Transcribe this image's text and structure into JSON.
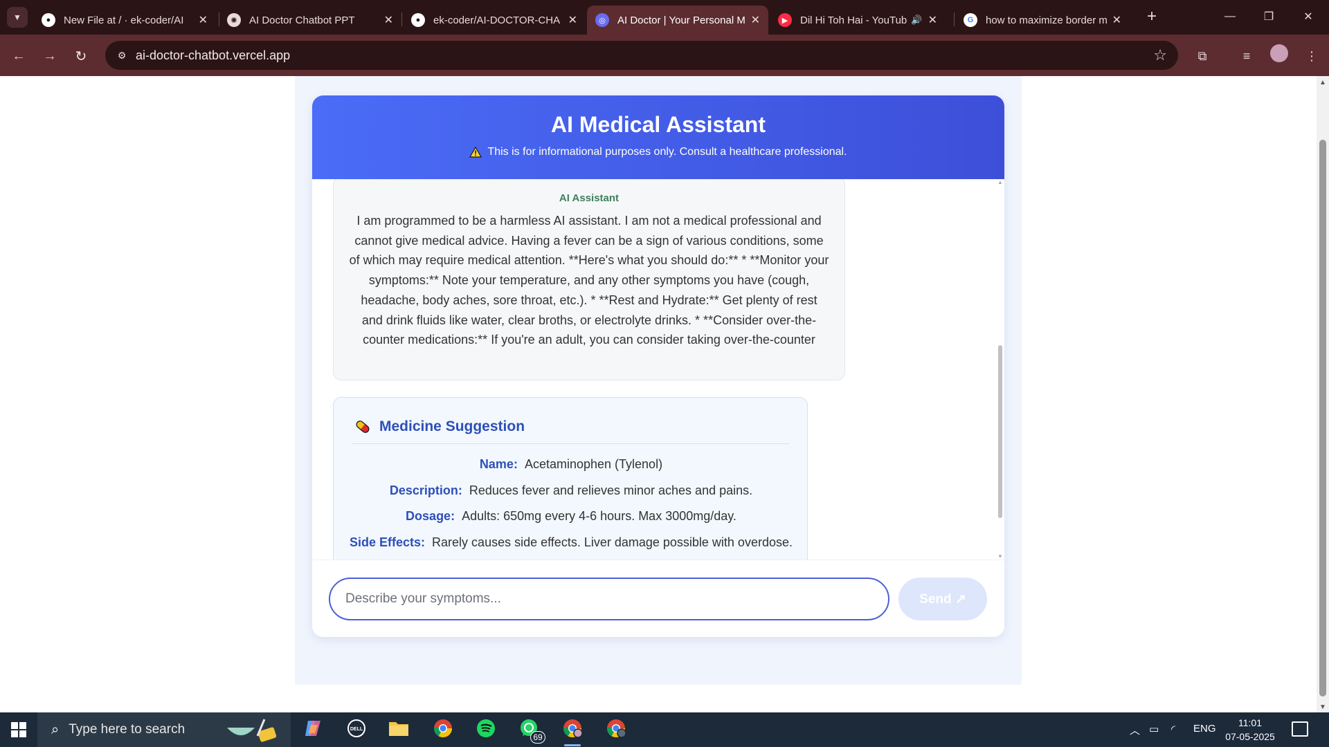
{
  "browser": {
    "tabs": [
      {
        "title": "New File at / · ek-coder/AI",
        "icon": "github-icon"
      },
      {
        "title": "AI Doctor Chatbot PPT",
        "icon": "openai-icon"
      },
      {
        "title": "ek-coder/AI-DOCTOR-CHA",
        "icon": "github-icon"
      },
      {
        "title": "AI Doctor | Your Personal M",
        "icon": "vercel-app-icon",
        "active": true
      },
      {
        "title": "Dil Hi Toh Hai - YouTub",
        "icon": "youtube-icon",
        "playing_audio": true
      },
      {
        "title": "how to maximize border m",
        "icon": "google-icon"
      }
    ],
    "url": "ai-doctor-chatbot.vercel.app"
  },
  "app": {
    "title": "AI Medical Assistant",
    "disclaimer": "This is for informational purposes only. Consult a healthcare professional.",
    "ai_message": {
      "sender": "AI Assistant",
      "text": "I am programmed to be a harmless AI assistant. I am not a medical professional and cannot give medical advice. Having a fever can be a sign of various conditions, some of which may require medical attention. **Here's what you should do:** * **Monitor your symptoms:** Note your temperature, and any other symptoms you have (cough, headache, body aches, sore throat, etc.). * **Rest and Hydrate:** Get plenty of rest and drink fluids like water, clear broths, or electrolyte drinks. * **Consider over-the-counter medications:** If you're an adult, you can consider taking over-the-counter fever reducers like acetaminophen (Tylenol) or ibuprofen ("
    },
    "medicine": {
      "heading": "Medicine Suggestion",
      "name_label": "Name:",
      "name": "Acetaminophen (Tylenol)",
      "description_label": "Description:",
      "description": "Reduces fever and relieves minor aches and pains.",
      "dosage_label": "Dosage:",
      "dosage": "Adults: 650mg every 4-6 hours. Max 3000mg/day.",
      "side_effects_label": "Side Effects:",
      "side_effects": "Rarely causes side effects. Liver damage possible with overdose."
    },
    "input": {
      "placeholder": "Describe your symptoms...",
      "value": ""
    },
    "send_label": "Send ↗"
  },
  "taskbar": {
    "search_placeholder": "Type here to search",
    "whatsapp_badge": "69",
    "language": "ENG",
    "time": "11:01",
    "date": "07-05-2025"
  },
  "colors": {
    "header_gradient_start": "#4a6cf7",
    "header_gradient_end": "#3d4fd9",
    "accent_text": "#2f4fb8",
    "sender_green": "#3f7f5f",
    "chrome_dark": "#2b1416",
    "chrome_toolbar": "#5c2c30"
  }
}
